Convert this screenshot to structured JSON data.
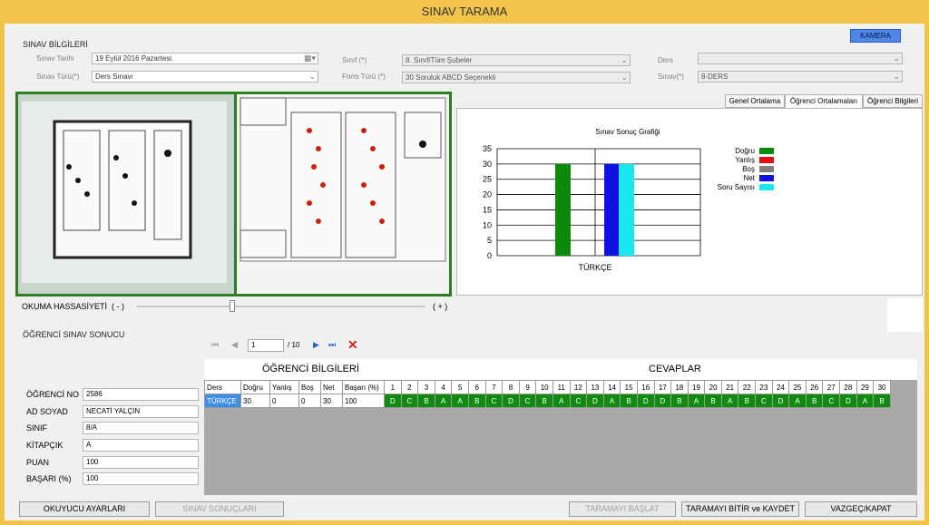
{
  "window": {
    "title": "SINAV TARAMA"
  },
  "camera_button": "KAMERA",
  "exam_info": {
    "group_title": "SINAV BİLGİLERİ",
    "date_label": "Sınav Tarihi",
    "date_value": "19   Eylül    2016  Pazartesi",
    "type_label": "Sınav Türü(*)",
    "type_value": "Ders Sınavı",
    "class_label": "Sınıf (*)",
    "class_value": "8. Sınıf/Tüm Şubeler",
    "form_label": "Form Türü (*)",
    "form_value": "30 Soruluk ABCD Seçenekli",
    "lesson_label": "Ders",
    "lesson_value": "",
    "exam_label": "Sınav(*)",
    "exam_value": "8-DERS"
  },
  "tabs": [
    "Genel Ortalama",
    "Öğrenci Ortalamaları",
    "Öğrenci Bilgileri"
  ],
  "chart_data": {
    "type": "bar",
    "title": "Sınav Sonuç Grafiği",
    "categories": [
      "TÜRKÇE"
    ],
    "ylim": [
      0,
      35
    ],
    "yticks": [
      0,
      5,
      10,
      15,
      20,
      25,
      30,
      35
    ],
    "series": [
      {
        "name": "Doğru",
        "values": [
          30
        ],
        "color": "#0a8a0a"
      },
      {
        "name": "Yanlış",
        "values": [
          0
        ],
        "color": "#e01010"
      },
      {
        "name": "Boş",
        "values": [
          0
        ],
        "color": "#808080"
      },
      {
        "name": "Net",
        "values": [
          30
        ],
        "color": "#1010e0"
      },
      {
        "name": "Soru Sayısı",
        "values": [
          30
        ],
        "color": "#19e8f0"
      }
    ]
  },
  "sensitivity": {
    "label": "OKUMA HASSASİYETİ",
    "minus": "( - )",
    "plus": "( + )",
    "value": 0.33
  },
  "result": {
    "group_title": "ÖĞRENCİ SINAV SONUCU",
    "fields": [
      {
        "label": "ÖĞRENCİ NO",
        "value": "2586"
      },
      {
        "label": "AD SOYAD",
        "value": "NECATİ YALÇIN"
      },
      {
        "label": "SINIF",
        "value": "8/A"
      },
      {
        "label": "KİTAPÇIK",
        "value": "A"
      },
      {
        "label": "PUAN",
        "value": "100"
      },
      {
        "label": "BAŞARI (%)",
        "value": "100"
      }
    ]
  },
  "navigator": {
    "position": "1",
    "total": "/ 10"
  },
  "grid": {
    "left_header": "ÖĞRENCİ BİLGİLERİ",
    "right_header": "CEVAPLAR",
    "columns": [
      "Ders",
      "Doğru",
      "Yanlış",
      "Boş",
      "Net",
      "Başarı (%)",
      "1",
      "2",
      "3",
      "4",
      "5",
      "6",
      "7",
      "8",
      "9",
      "10",
      "11",
      "12",
      "13",
      "14",
      "15",
      "16",
      "17",
      "18",
      "19",
      "20",
      "21",
      "22",
      "23",
      "24",
      "25",
      "26",
      "27",
      "28",
      "29",
      "30"
    ],
    "row": [
      "TÜRKÇE",
      "30",
      "0",
      "0",
      "30",
      "100",
      "D",
      "C",
      "B",
      "A",
      "A",
      "B",
      "C",
      "D",
      "C",
      "B",
      "A",
      "C",
      "D",
      "A",
      "B",
      "D",
      "D",
      "B",
      "A",
      "B",
      "A",
      "B",
      "C",
      "D",
      "A",
      "B",
      "C",
      "D",
      "A",
      "B"
    ]
  },
  "buttons": {
    "reader": "OKUYUCU AYARLARI",
    "results": "SINAV SONUÇLARI",
    "start": "TARAMAYI BAŞLAT",
    "finish": "TARAMAYI BİTİR ve KAYDET",
    "cancel": "VAZGEÇ/KAPAT"
  }
}
